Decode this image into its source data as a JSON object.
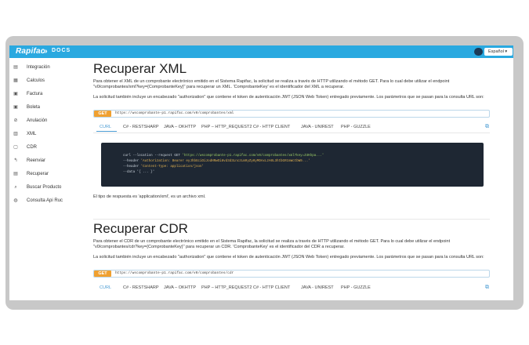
{
  "header": {
    "logo": "Rapifac",
    "docs": "DOCS",
    "language": "Español"
  },
  "sidebar": {
    "items": [
      {
        "label": "Integración",
        "icon": "book-icon"
      },
      {
        "label": "Calculos",
        "icon": "calculator-icon"
      },
      {
        "label": "Factura",
        "icon": "invoice-icon"
      },
      {
        "label": "Boleta",
        "icon": "receipt-icon"
      },
      {
        "label": "Anulación",
        "icon": "cancel-icon"
      },
      {
        "label": "XML",
        "icon": "xml-icon"
      },
      {
        "label": "CDR",
        "icon": "cdr-icon"
      },
      {
        "label": "Reenviar",
        "icon": "resend-icon"
      },
      {
        "label": "Recuperar",
        "icon": "recover-icon"
      },
      {
        "label": "Buscar Producto",
        "icon": "search-product-icon"
      },
      {
        "label": "Consulta Api Ruc",
        "icon": "globe-icon"
      }
    ]
  },
  "xml_section": {
    "title": "Recuperar XML",
    "para1": "Para obtener el XML de un comprobante electrónico emitido en el Sistema Rapifac, la solicitud se realiza a través de HTTP utilizando el método GET. Para lo cual debe utilizar el endpoint \"v0/comprobantes/xml?key={ComprobanteKey}\" para recuperar un XML. 'ComprobanteKey' es el identificador del XML a recuperar.",
    "para2": "La solicitud también incluye un encabezado \"authorization\" que contiene el token de autenticación JWT (JSON Web Token) entregado previamente. Los parámetros que se pasan para la consulta URL son:",
    "method": "GET",
    "url": "https://wscomprobante-p1.rapifac.com/v0/comprobantes/xml",
    "tabs": [
      "CURL",
      "C# - RESTSHARP",
      "JAVA – OKHTTP",
      "PHP – HTTP_REQUEST2",
      "C# - HTTP CLIENT",
      "JAVA - UNIREST",
      "PHP - GUZZLE"
    ],
    "code": {
      "l1a": "curl --location --request GET ",
      "l1b": "'https://wscomprobante-p1.rapifac.com/v0/comprobantes/xml?key=Z4Khpa...'",
      "l2a": "--header ",
      "l2b": "'Authorization: Bearer eyJhbGciOiJodHRwOi8vd3d3LnczLm9yZy8yMDAxLzA0L3htbGRzaWctbW9...'",
      "l3a": "--header ",
      "l3b": "'Content-Type: application/json'",
      "l4": "--data '{ ... }'"
    },
    "response": "El tipo de respuesta es 'application/xml', es un archivo xml."
  },
  "cdr_section": {
    "title": "Recuperar CDR",
    "para1": "Para obtener el CDR de un comprobante electrónico emitido en el Sistema Rapifac, la solicitud se realiza a través de HTTP utilizando el método GET. Para lo cual debe utilizar el endpoint \"v0/comprobantes/cdr?key={ComprobanteKey}\" para recuperar un CDR. 'ComprobanteKey' es el identificador del CDR a recuperar.",
    "para2": "La solicitud también incluye un encabezado \"authorization\" que contiene el token de autenticación JWT (JSON Web Token) entregado previamente. Los parámetros que se pasan para la consulta URL son:",
    "method": "GET",
    "url": "https://wscomprobante-p1.rapifac.com/v0/comprobantes/cdr",
    "tabs": [
      "CURL",
      "C# - RESTSHARP",
      "JAVA – OKHTTP",
      "PHP – HTTP_REQUEST2",
      "C# - HTTP CLIENT",
      "JAVA - UNIREST",
      "PHP - GUZZLE"
    ]
  },
  "colors": {
    "topbar": "#2aa9e0",
    "get_tag": "#f0a030",
    "tab_active": "#4b9cd3",
    "code_bg": "#1e2733"
  }
}
